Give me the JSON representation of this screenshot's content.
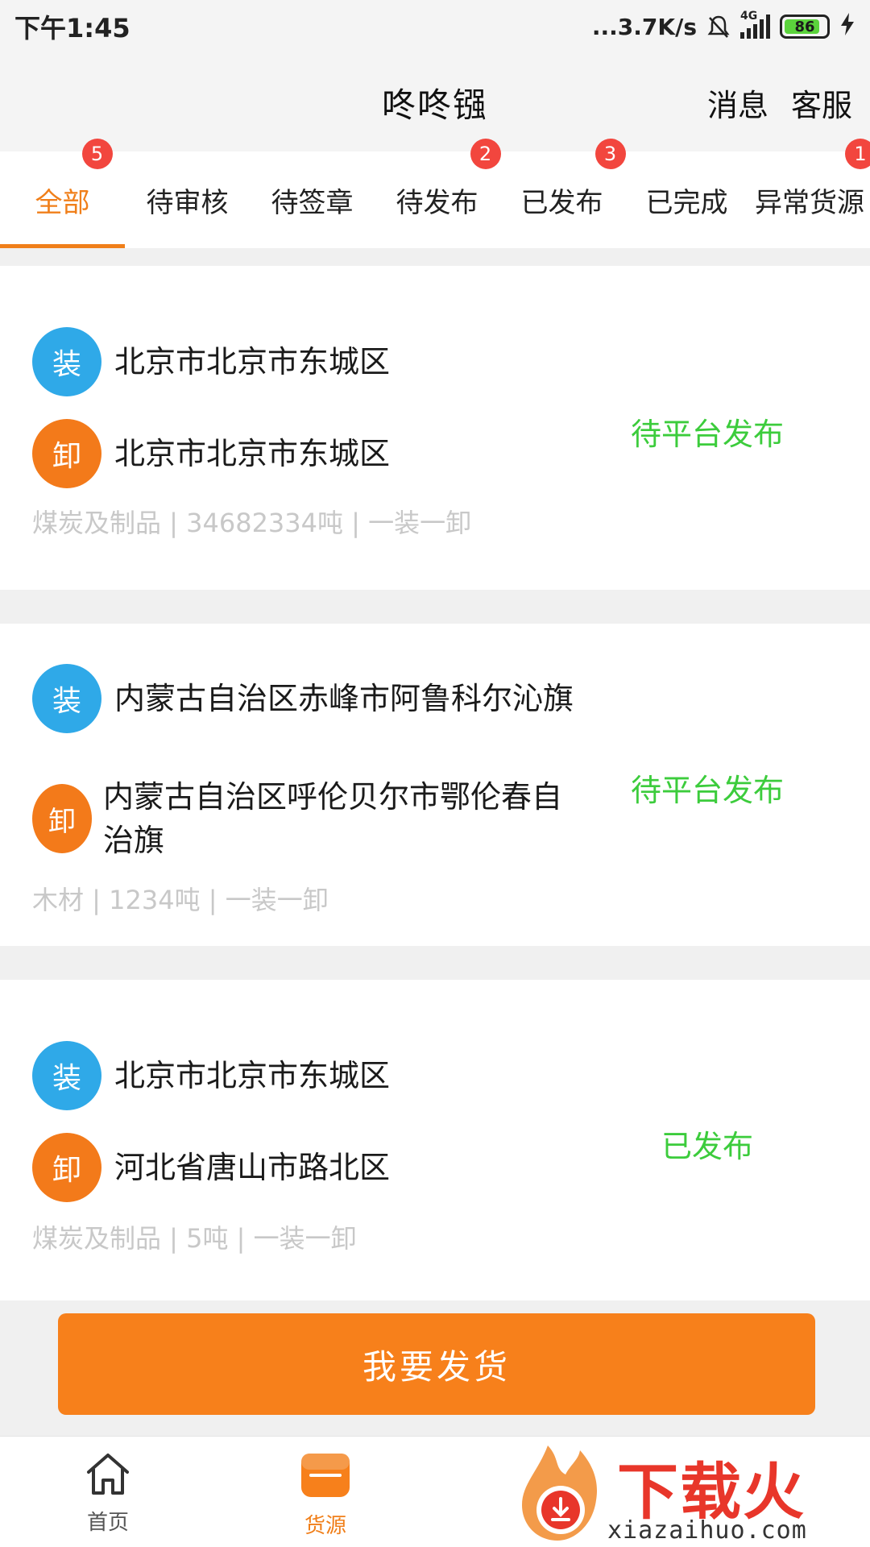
{
  "status_bar": {
    "time": "下午1:45",
    "net_speed": "...3.7K/s",
    "network": "4G",
    "battery": "86",
    "battery_level": 0.86
  },
  "header": {
    "title": "咚咚镪",
    "actions": [
      "消息",
      "客服"
    ]
  },
  "tabs": [
    {
      "label": "全部",
      "badge": "5",
      "active": true
    },
    {
      "label": "待审核",
      "badge": ""
    },
    {
      "label": "待签章",
      "badge": ""
    },
    {
      "label": "待发布",
      "badge": "2"
    },
    {
      "label": "已发布",
      "badge": "3"
    },
    {
      "label": "已完成",
      "badge": ""
    },
    {
      "label": "异常货源",
      "badge": "1"
    }
  ],
  "route_icons": {
    "load": "装",
    "unload": "卸"
  },
  "cards": [
    {
      "load": "北京市北京市东城区",
      "unload": "北京市北京市东城区",
      "cargo": "煤炭及制品 | 34682334吨 | 一装一卸",
      "status": "待平台发布"
    },
    {
      "load": "内蒙古自治区赤峰市阿鲁科尔沁旗",
      "unload": "内蒙古自治区呼伦贝尔市鄂伦春自治旗",
      "cargo": "木材 | 1234吨 | 一装一卸",
      "status": "待平台发布"
    },
    {
      "load": "北京市北京市东城区",
      "unload": "河北省唐山市路北区",
      "cargo": "煤炭及制品 | 5吨 | 一装一卸",
      "status": "已发布"
    }
  ],
  "primary_button": "我要发货",
  "bottom_nav": [
    {
      "label": "首页",
      "icon": "home-icon"
    },
    {
      "label": "货源",
      "icon": "cargo-source-icon",
      "active": true
    }
  ],
  "watermark": {
    "title": "下载火",
    "url": "xiazaihuo.com"
  },
  "colors": {
    "accent": "#f07f1a",
    "load_icon": "#2fa9e8",
    "unload_icon": "#f37a1a",
    "status_green": "#3ccc3c",
    "badge_red": "#f2463e"
  }
}
